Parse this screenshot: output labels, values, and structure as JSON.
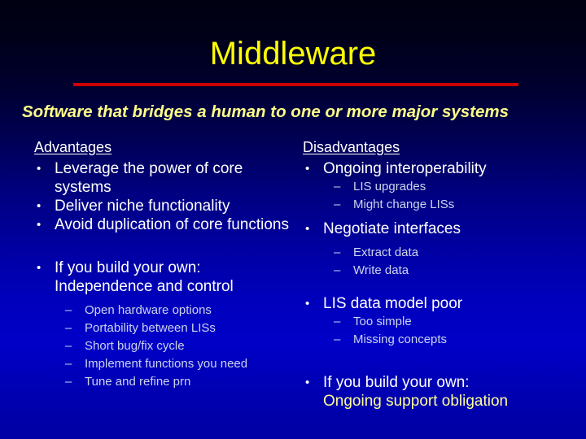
{
  "slide": {
    "title": "Middleware",
    "subtitle": "Software that bridges a human to one or more major systems",
    "colors": {
      "title": "#ffff00",
      "subtitle": "#ffff88",
      "rule": "#cc0000",
      "body_text": "#ffffff",
      "sub_text": "#ccd4ec",
      "accent_text": "#ffff99",
      "background_top": "#000012",
      "background_bottom": "#0000a6"
    },
    "markers": {
      "bullet": "•",
      "subbullet": "–"
    },
    "columns": {
      "left": {
        "header": "Advantages",
        "items": [
          {
            "text": "Leverage the power of core systems"
          },
          {
            "text": "Deliver niche functionality"
          },
          {
            "text": "Avoid duplication of core functions"
          }
        ],
        "group": {
          "line1": "If you build your own:",
          "line2": "Independence and control",
          "line2_accent": false,
          "subitems": [
            "Open hardware options",
            "Portability between LISs",
            "Short bug/fix cycle",
            "Implement functions you need",
            "Tune and refine prn"
          ]
        }
      },
      "right": {
        "header": "Disadvantages",
        "items": [
          {
            "text": "Ongoing interoperability",
            "subitems": [
              "LIS upgrades",
              "Might change LISs"
            ]
          },
          {
            "text": "Negotiate interfaces",
            "subitems": [
              "Extract data",
              "Write data"
            ]
          },
          {
            "text": "LIS data model poor",
            "subitems": [
              "Too simple",
              "Missing concepts"
            ]
          }
        ],
        "group": {
          "line1": "If you build your own:",
          "line2": "Ongoing support obligation",
          "line2_accent": true,
          "subitems": []
        }
      }
    }
  }
}
